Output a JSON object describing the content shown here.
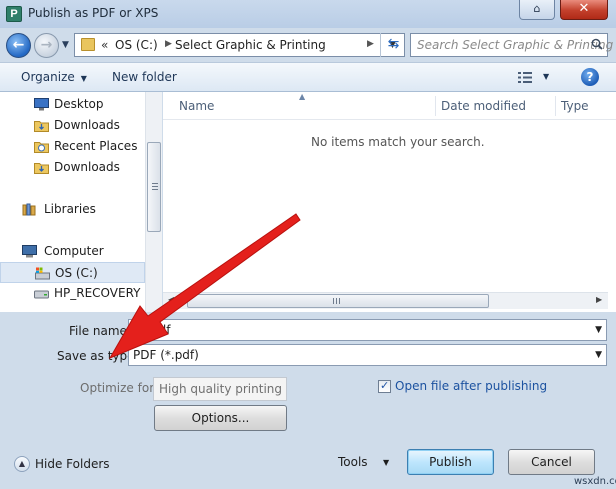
{
  "window": {
    "title": "Publish as PDF or XPS",
    "app_icon_letter": "P",
    "close_glyph": "✕",
    "help_glyph": "⌂"
  },
  "address": {
    "chevron": "«",
    "segments": [
      "OS (C:)",
      "Select Graphic & Printing"
    ],
    "search_placeholder": "Search Select Graphic & Printing"
  },
  "toolbar": {
    "organize": "Organize",
    "new_folder": "New folder",
    "help": "?"
  },
  "nav": {
    "items": [
      {
        "label": "Desktop",
        "icon": "desktop-icon"
      },
      {
        "label": "Downloads",
        "icon": "folder-icon"
      },
      {
        "label": "Recent Places",
        "icon": "recent-places-icon"
      },
      {
        "label": "Downloads",
        "icon": "folder-icon"
      }
    ],
    "libraries": "Libraries",
    "computer": "Computer",
    "drives": [
      {
        "label": "OS (C:)",
        "selected": true
      },
      {
        "label": "HP_RECOVERY (D",
        "selected": false
      }
    ]
  },
  "columns": [
    "Name",
    "Date modified",
    "Type"
  ],
  "empty_message": "No items match your search.",
  "form": {
    "file_name_label": "File name:",
    "file_name_value": "s.pdf",
    "save_type_label": "Save as type:",
    "save_type_value": "PDF (*.pdf)",
    "optimize_label": "Optimize for:",
    "optimize_value": "High quality printing",
    "options_button": "Options...",
    "open_after_label": "Open file after publishing",
    "open_after_checked": true
  },
  "footer": {
    "hide_folders": "Hide Folders",
    "tools": "Tools",
    "publish": "Publish",
    "cancel": "Cancel"
  },
  "colors": {
    "accent_red": "#e4201c",
    "link_blue": "#1c52a0"
  },
  "watermark": "wsxdn.com"
}
